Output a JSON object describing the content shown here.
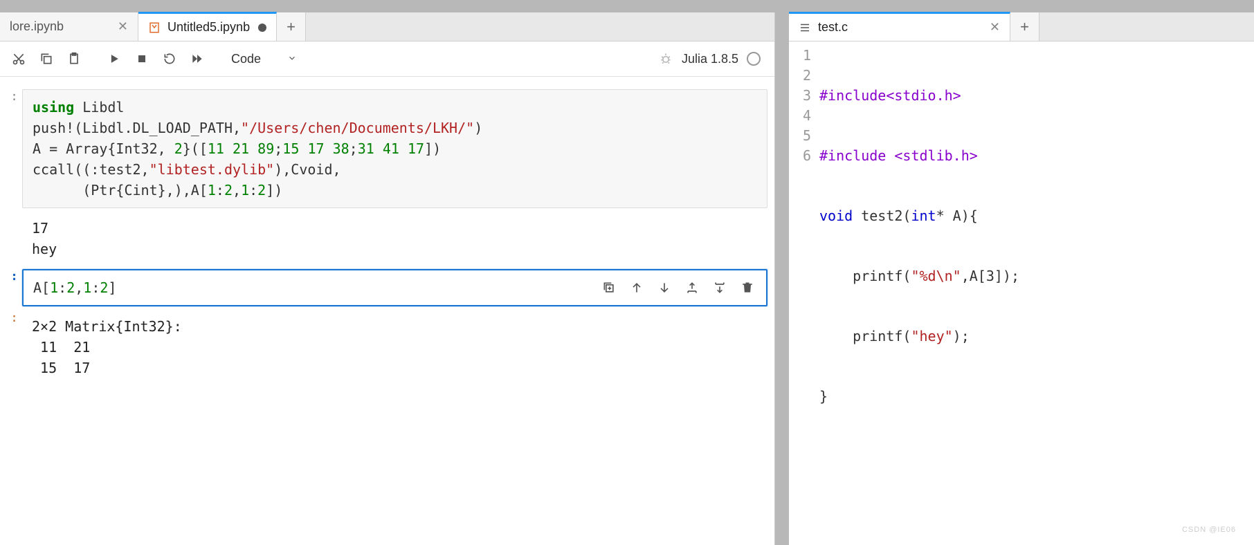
{
  "leftTabs": [
    {
      "label": "lore.ipynb",
      "active": false,
      "dirty": false
    },
    {
      "label": "Untitled5.ipynb",
      "active": true,
      "dirty": true
    }
  ],
  "rightTabs": [
    {
      "label": "test.c",
      "active": true
    }
  ],
  "toolbar": {
    "cellType": "Code",
    "kernel": "Julia 1.8.5"
  },
  "cells": {
    "c1": {
      "code": {
        "l1_kw": "using",
        "l1_rest": " Libdl",
        "l2_a": "push!(Libdl.DL_LOAD_PATH,",
        "l2_str": "\"/Users/chen/Documents/LKH/\"",
        "l2_b": ")",
        "l3_a": "A = Array{Int32, ",
        "l3_n1": "2",
        "l3_b": "}([",
        "l3_n2": "11",
        "l3_sp": " ",
        "l3_n3": "21",
        "l3_n4": "89",
        "l3_sc": ";",
        "l3_n5": "15",
        "l3_n6": "17",
        "l3_n7": "38",
        "l3_n8": "31",
        "l3_n9": "41",
        "l3_n10": "17",
        "l3_c": "])",
        "l4_a": "ccall((:test2,",
        "l4_str": "\"libtest.dylib\"",
        "l4_b": "),Cvoid,",
        "l5_a": "      (Ptr{Cint},),A[",
        "l5_n1": "1",
        "l5_col": ":",
        "l5_n2": "2",
        "l5_com": ",",
        "l5_n3": "1",
        "l5_n4": "2",
        "l5_b": "])"
      },
      "output": "17\nhey"
    },
    "c2": {
      "code_a": "A[",
      "code_n1": "1",
      "code_col": ":",
      "code_n2": "2",
      "code_com": ",",
      "code_n3": "1",
      "code_n4": "2",
      "code_b": "]",
      "output": "2×2 Matrix{Int32}:\n 11  21\n 15  17"
    }
  },
  "editor": {
    "lineNumbers": [
      "1",
      "2",
      "3",
      "4",
      "5",
      "6"
    ],
    "lines": {
      "l1_pre": "#include<stdio.h>",
      "l2_pre": "#include <stdlib.h>",
      "l3_kw": "void",
      "l3_rest_a": " test2(",
      "l3_kw2": "int",
      "l3_rest_b": "* A){",
      "l4_a": "    printf(",
      "l4_str": "\"%d\\n\"",
      "l4_b": ",A[3]);",
      "l5_a": "    printf(",
      "l5_str": "\"hey\"",
      "l5_b": ");",
      "l6": "}"
    }
  },
  "watermark": "CSDN @IE06"
}
